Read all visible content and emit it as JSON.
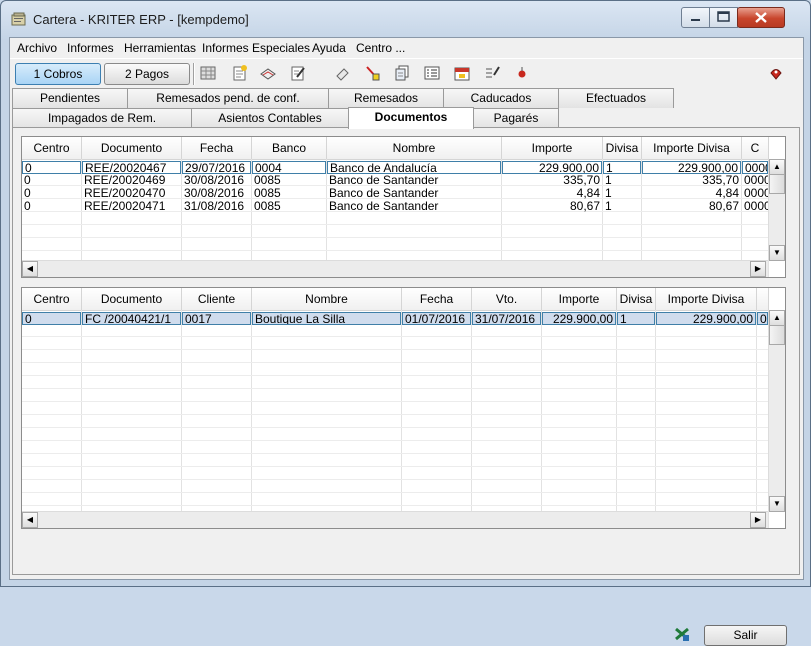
{
  "window": {
    "title": "Cartera - KRITER ERP - [kempdemo]"
  },
  "menu": [
    "Archivo",
    "Informes",
    "Herramientas",
    "Informes Especiales",
    "Ayuda",
    "Centro ..."
  ],
  "toolbar": {
    "cobros_label": "1 Cobros",
    "pagos_label": "2 Pagos"
  },
  "tabs_row1": [
    "Pendientes",
    "Remesados pend. de conf.",
    "Remesados",
    "Caducados",
    "Efectuados"
  ],
  "tabs_row2": [
    "Impagados de Rem.",
    "Asientos Contables",
    "Documentos",
    "Pagarés"
  ],
  "selected_tab": "Documentos",
  "grid1": {
    "columns": [
      "Centro",
      "Documento",
      "Fecha",
      "Banco",
      "Nombre",
      "Importe",
      "Divisa",
      "Importe Divisa",
      "C"
    ],
    "rows": [
      [
        "0",
        "REE/20020467",
        "29/07/2016",
        "0004",
        "Banco de Andalucía",
        "229.900,00",
        "1",
        "229.900,00",
        "0000"
      ],
      [
        "0",
        "REE/20020469",
        "30/08/2016",
        "0085",
        "Banco de Santander",
        "335,70",
        "1",
        "335,70",
        "0000"
      ],
      [
        "0",
        "REE/20020470",
        "30/08/2016",
        "0085",
        "Banco de Santander",
        "4,84",
        "1",
        "4,84",
        "0000"
      ],
      [
        "0",
        "REE/20020471",
        "31/08/2016",
        "0085",
        "Banco de Santander",
        "80,67",
        "1",
        "80,67",
        "0000"
      ]
    ]
  },
  "grid2": {
    "columns": [
      "Centro",
      "Documento",
      "Cliente",
      "Nombre",
      "Fecha",
      "Vto.",
      "Importe",
      "Divisa",
      "Importe Divisa"
    ],
    "rows": [
      [
        "0",
        "FC /20040421/1",
        "0017",
        "Boutique La Silla",
        "01/07/2016",
        "31/07/2016",
        "229.900,00",
        "1",
        "229.900,00",
        "0"
      ]
    ]
  },
  "footer": {
    "salir_label": "Salir"
  }
}
